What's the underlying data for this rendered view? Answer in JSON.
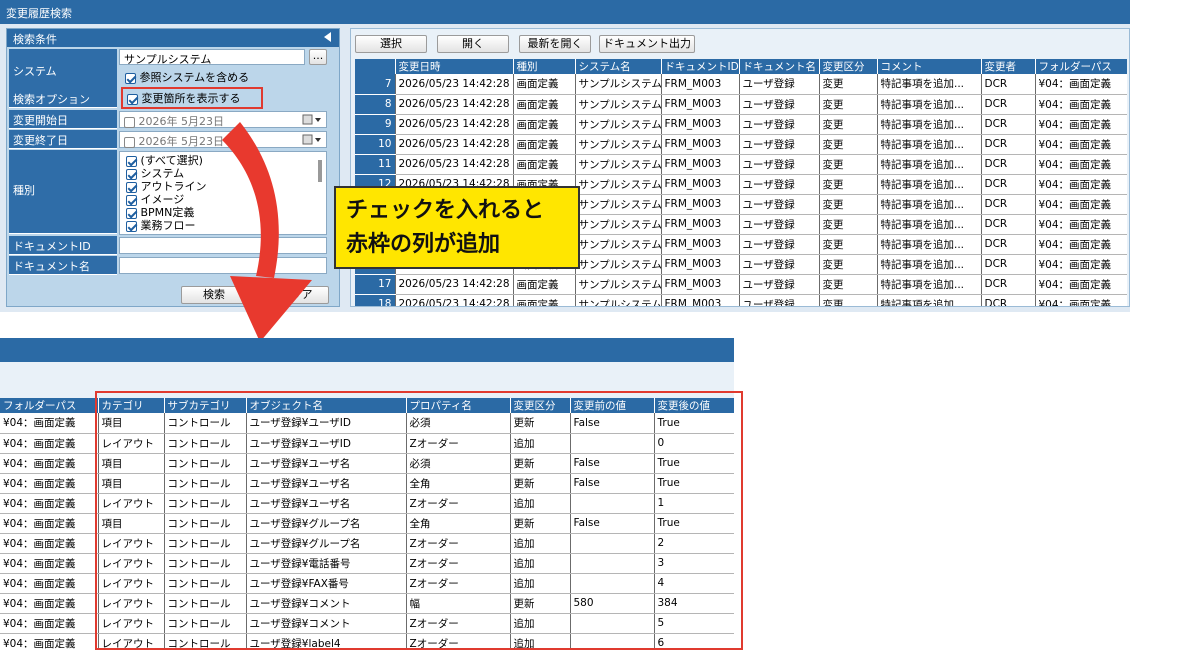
{
  "window": {
    "title": "変更履歴検索"
  },
  "search_panel": {
    "header": "検索条件",
    "system_label": "システム",
    "system_value": "サンプルシステム",
    "browse_button": "...",
    "include_ref_label": "参照システムを含める",
    "search_option_label": "検索オプション",
    "show_changes_label": "変更箇所を表示する",
    "start_date_label": "変更開始日",
    "start_date_value": "2026年  5月23日",
    "end_date_label": "変更終了日",
    "end_date_value": "2026年  5月23日",
    "type_label": "種別",
    "type_options": [
      "(すべて選択)",
      "システム",
      "アウトライン",
      "イメージ",
      "BPMN定義",
      "業務フロー"
    ],
    "doc_id_label": "ドキュメントID",
    "doc_name_label": "ドキュメント名",
    "search_button": "検索",
    "clear_button": "クリア"
  },
  "toolbar": {
    "select_button": "選択",
    "open_button": "開く",
    "open_latest_button": "最新を開く",
    "export_button": "ドキュメント出力"
  },
  "top_grid": {
    "columns": [
      "変更日時",
      "種別",
      "システム名",
      "ドキュメントID",
      "ドキュメント名",
      "変更区分",
      "コメント",
      "変更者",
      "フォルダーパス"
    ],
    "row_numbers": [
      "7",
      "8",
      "9",
      "10",
      "11",
      "12",
      "13",
      "14",
      "15",
      "16",
      "17",
      "18"
    ],
    "row": {
      "datetime": "2026/05/23 14:42:28",
      "type": "画面定義",
      "system": "サンプルシステム",
      "doc_id": "FRM_M003",
      "doc_name": "ユーザ登録",
      "change_kind": "変更",
      "comment": "特記事項を追加...",
      "changer": "DCR",
      "folder": "¥04：画面定義"
    }
  },
  "callout": {
    "line1": "チェックを入れると",
    "line2": "赤枠の列が追加"
  },
  "bottom_grid": {
    "columns": [
      "フォルダーパス",
      "カテゴリ",
      "サブカテゴリ",
      "オブジェクト名",
      "プロパティ名",
      "変更区分",
      "変更前の値",
      "変更後の値"
    ],
    "rows": [
      [
        "¥04：画面定義",
        "項目",
        "コントロール",
        "ユーザ登録¥ユーザID",
        "必須",
        "更新",
        "False",
        "True"
      ],
      [
        "¥04：画面定義",
        "レイアウト",
        "コントロール",
        "ユーザ登録¥ユーザID",
        "Zオーダー",
        "追加",
        "",
        "0"
      ],
      [
        "¥04：画面定義",
        "項目",
        "コントロール",
        "ユーザ登録¥ユーザ名",
        "必須",
        "更新",
        "False",
        "True"
      ],
      [
        "¥04：画面定義",
        "項目",
        "コントロール",
        "ユーザ登録¥ユーザ名",
        "全角",
        "更新",
        "False",
        "True"
      ],
      [
        "¥04：画面定義",
        "レイアウト",
        "コントロール",
        "ユーザ登録¥ユーザ名",
        "Zオーダー",
        "追加",
        "",
        "1"
      ],
      [
        "¥04：画面定義",
        "項目",
        "コントロール",
        "ユーザ登録¥グループ名",
        "全角",
        "更新",
        "False",
        "True"
      ],
      [
        "¥04：画面定義",
        "レイアウト",
        "コントロール",
        "ユーザ登録¥グループ名",
        "Zオーダー",
        "追加",
        "",
        "2"
      ],
      [
        "¥04：画面定義",
        "レイアウト",
        "コントロール",
        "ユーザ登録¥電話番号",
        "Zオーダー",
        "追加",
        "",
        "3"
      ],
      [
        "¥04：画面定義",
        "レイアウト",
        "コントロール",
        "ユーザ登録¥FAX番号",
        "Zオーダー",
        "追加",
        "",
        "4"
      ],
      [
        "¥04：画面定義",
        "レイアウト",
        "コントロール",
        "ユーザ登録¥コメント",
        "幅",
        "更新",
        "580",
        "384"
      ],
      [
        "¥04：画面定義",
        "レイアウト",
        "コントロール",
        "ユーザ登録¥コメント",
        "Zオーダー",
        "追加",
        "",
        "5"
      ],
      [
        "¥04：画面定義",
        "レイアウト",
        "コントロール",
        "ユーザ登録¥label4",
        "Zオーダー",
        "追加",
        "",
        "6"
      ]
    ]
  },
  "colors": {
    "header_blue": "#2b6aa5",
    "highlight_red": "#e03a2f",
    "callout_yellow": "#ffe600"
  }
}
